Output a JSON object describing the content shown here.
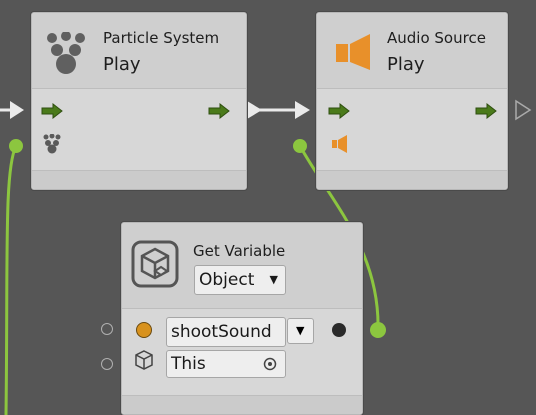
{
  "nodes": {
    "particle_system": {
      "category": "Particle System",
      "action": "Play"
    },
    "audio_source": {
      "category": "Audio Source",
      "action": "Play"
    },
    "get_variable": {
      "title": "Get Variable",
      "kind": "Object",
      "variable_name": "shootSound",
      "target": "This"
    }
  },
  "colors": {
    "flow_arrow": "#4a7a1a",
    "connection_green": "#8cc63f",
    "audio_orange": "#e8902a",
    "object_port": "#d8921e"
  },
  "icons": [
    "particle-system-icon",
    "audio-source-icon",
    "variable-cube-icon",
    "flow-arrow-icon",
    "dropdown-arrow-icon",
    "target-icon",
    "object-cube-icon"
  ]
}
